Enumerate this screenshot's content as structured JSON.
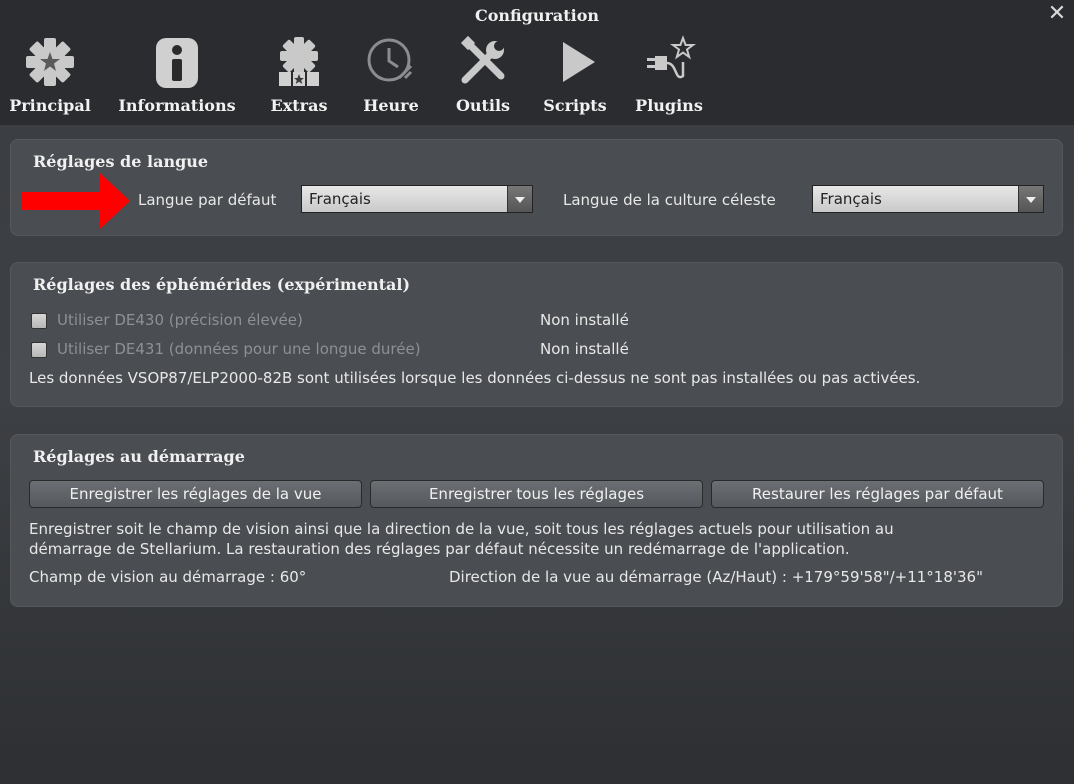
{
  "window": {
    "title": "Configuration",
    "close_icon": "close-icon"
  },
  "tabs": [
    {
      "label": "Principal",
      "icon": "gear-icon"
    },
    {
      "label": "Informations",
      "icon": "info-icon"
    },
    {
      "label": "Extras",
      "icon": "extras-gear-stars-icon"
    },
    {
      "label": "Heure",
      "icon": "clock-icon"
    },
    {
      "label": "Outils",
      "icon": "tools-icon"
    },
    {
      "label": "Scripts",
      "icon": "play-icon"
    },
    {
      "label": "Plugins",
      "icon": "plug-star-icon"
    }
  ],
  "language": {
    "title": "Réglages de langue",
    "default_label": "Langue par défaut",
    "default_value": "Français",
    "sky_culture_label": "Langue de la culture céleste",
    "sky_culture_value": "Français"
  },
  "ephemeris": {
    "title": "Réglages des éphémérides (expérimental)",
    "de430_label": "Utiliser DE430 (précision élevée)",
    "de430_status": "Non installé",
    "de431_label": "Utiliser DE431 (données pour une longue durée)",
    "de431_status": "Non installé",
    "note": "Les données VSOP87/ELP2000-82B sont utilisées lorsque les données ci-dessus ne sont pas installées ou pas activées."
  },
  "startup": {
    "title": "Réglages au démarrage",
    "save_view_button": "Enregistrer les réglages de la vue",
    "save_all_button": "Enregistrer tous les réglages",
    "restore_button": "Restaurer les réglages par défaut",
    "description_line1": "Enregistrer soit le champ de vision ainsi que la direction de la vue, soit tous les réglages actuels pour utilisation au",
    "description_line2": "démarrage de Stellarium. La restauration des réglages par défaut nécessite un redémarrage de l'application.",
    "fov_label": "Champ de vision au démarrage : 60°",
    "direction_label": "Direction de la vue au démarrage (Az/Haut) : +179°59'58\"/+11°18'36\""
  },
  "colors": {
    "annotation_arrow": "#ff0000"
  }
}
